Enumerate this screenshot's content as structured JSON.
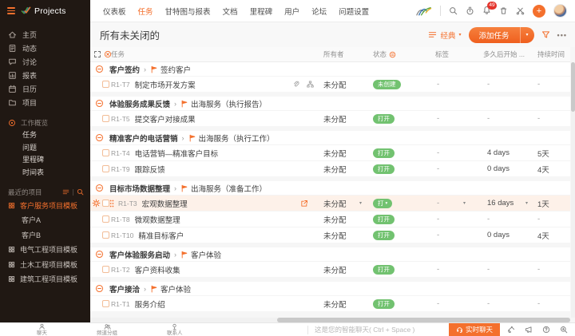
{
  "topbar": {
    "logo_text": "Projects",
    "nav_items": [
      {
        "label": "仪表板",
        "active": false
      },
      {
        "label": "任务",
        "active": true
      },
      {
        "label": "甘特图与报表",
        "active": false
      },
      {
        "label": "文档",
        "active": false
      },
      {
        "label": "里程碑",
        "active": false
      },
      {
        "label": "用户",
        "active": false
      },
      {
        "label": "论坛",
        "active": false
      },
      {
        "label": "问题设置",
        "active": false
      }
    ],
    "notification_count": "49"
  },
  "sidebar": {
    "main_items": [
      {
        "label": "主页",
        "icon": "home"
      },
      {
        "label": "动态",
        "icon": "feed"
      },
      {
        "label": "讨论",
        "icon": "chat"
      },
      {
        "label": "报表",
        "icon": "report"
      },
      {
        "label": "日历",
        "icon": "calendar"
      },
      {
        "label": "项目",
        "icon": "folder"
      }
    ],
    "overview": {
      "label": "工作概览",
      "items": [
        "任务",
        "问题",
        "里程碑",
        "时间表"
      ]
    },
    "recent": {
      "label": "最近的项目",
      "items": [
        {
          "label": "客户服务项目模板",
          "active": true,
          "icon": true
        },
        {
          "label": "客户A",
          "active": false,
          "icon": false
        },
        {
          "label": "客户B",
          "active": false,
          "icon": false
        },
        {
          "label": "电气工程项目模板",
          "active": false,
          "icon": true
        },
        {
          "label": "土木工程项目模板",
          "active": false,
          "icon": true
        },
        {
          "label": "建筑工程项目模板",
          "active": false,
          "icon": true
        }
      ]
    }
  },
  "page": {
    "title": "所有未关闭的",
    "view_label": "经典",
    "add_task_label": "添加任务"
  },
  "table": {
    "columns": [
      "任务",
      "所有者",
      "状态",
      "标签",
      "多久后开始 ...",
      "持续时间"
    ],
    "groups": [
      {
        "title": "客户签约",
        "milestone": "签约客户",
        "rows": [
          {
            "id": "R1-T7",
            "title": "制定市场开发方案",
            "has_attachment": true,
            "has_subtasks": true,
            "owner": "未分配",
            "status": "未创建",
            "label": "-",
            "start": "-",
            "duration": "-"
          }
        ]
      },
      {
        "title": "体验服务成果反馈",
        "milestone": "出海服务（执行报告）",
        "rows": [
          {
            "id": "R1-T5",
            "title": "提交客户对接成果",
            "owner": "未分配",
            "status": "打开",
            "label": "-",
            "start": "-",
            "duration": "-"
          }
        ]
      },
      {
        "title": "精准客户的电话营销",
        "milestone": "出海服务（执行工作）",
        "rows": [
          {
            "id": "R1-T4",
            "title": "电话营销—精准客户目标",
            "owner": "未分配",
            "status": "打开",
            "label": "-",
            "start": "4 days",
            "duration": "5天"
          },
          {
            "id": "R1-T9",
            "title": "跟踪反馈",
            "owner": "未分配",
            "status": "打开",
            "label": "-",
            "start": "0 days",
            "duration": "4天"
          }
        ]
      },
      {
        "title": "目标市场数据整理",
        "milestone": "出海服务（准备工作）",
        "rows": [
          {
            "id": "R1-T3",
            "title": "宏观数据整理",
            "hovered": true,
            "owner": "未分配",
            "status": "打",
            "label": "-",
            "start": "16 days",
            "duration": "1天"
          },
          {
            "id": "R1-T8",
            "title": "微观数据整理",
            "owner": "未分配",
            "status": "打开",
            "label": "-",
            "start": "-",
            "duration": "-"
          },
          {
            "id": "R1-T10",
            "title": "精准目标客户",
            "owner": "未分配",
            "status": "打开",
            "label": "-",
            "start": "0 days",
            "duration": "4天"
          }
        ]
      },
      {
        "title": "客户体验服务启动",
        "milestone": "客户体验",
        "rows": [
          {
            "id": "R1-T2",
            "title": "客户资料收集",
            "owner": "未分配",
            "status": "打开",
            "label": "-",
            "start": "-",
            "duration": "-"
          }
        ]
      },
      {
        "title": "客户接洽",
        "milestone": "客户体验",
        "rows": [
          {
            "id": "R1-T1",
            "title": "服务介绍",
            "owner": "未分配",
            "status": "打开",
            "label": "-",
            "start": "-",
            "duration": "-"
          }
        ]
      }
    ]
  },
  "bottombar": {
    "items": [
      "聊天",
      "频道分组",
      "联系人"
    ],
    "input_placeholder": "这是您的智能聊天( Ctrl + Space )",
    "live_chat_label": "实时聊天"
  },
  "colors": {
    "accent": "#f4702d",
    "status_green": "#72c270",
    "badge_red": "#e4342c",
    "sidebar_bg": "#201813"
  }
}
